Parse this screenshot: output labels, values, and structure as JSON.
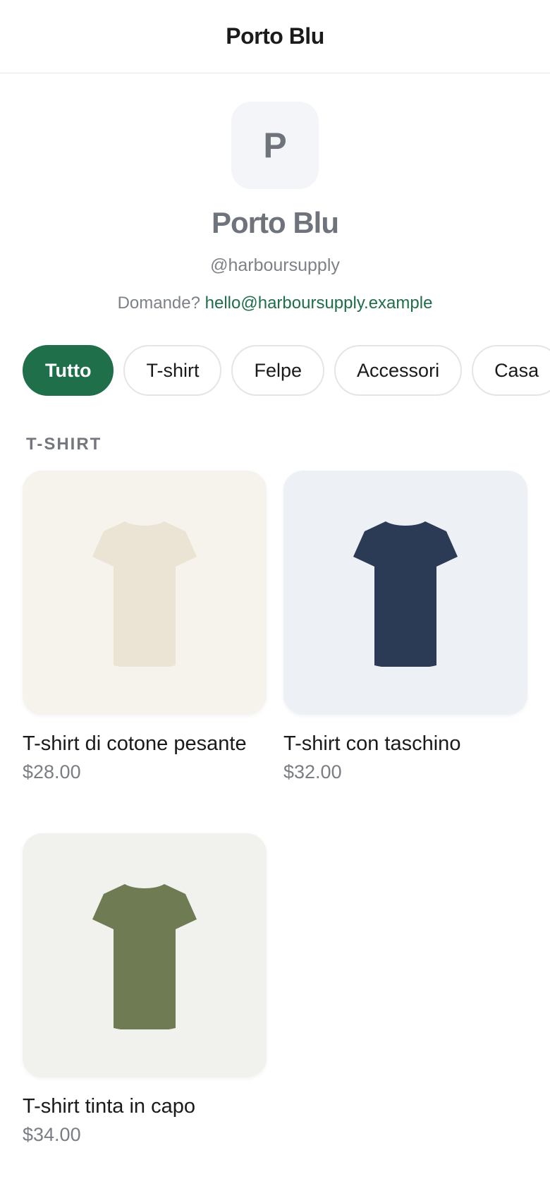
{
  "header": {
    "title": "Porto Blu"
  },
  "profile": {
    "avatar_letter": "P",
    "name": "Porto Blu",
    "handle": "@harboursupply",
    "contact_prefix": "Domande?",
    "contact_email": "hello@harboursupply.example"
  },
  "categories": [
    {
      "label": "Tutto",
      "active": true
    },
    {
      "label": "T-shirt",
      "active": false
    },
    {
      "label": "Felpe",
      "active": false
    },
    {
      "label": "Accessori",
      "active": false
    },
    {
      "label": "Casa",
      "active": false
    }
  ],
  "section": {
    "label": "T-SHIRT"
  },
  "products": [
    {
      "title": "T-shirt di cotone pesante",
      "price": "$28.00",
      "bg_color": "#f6f2ec",
      "shirt_color": "#ebe3d3",
      "icon": "tshirt-icon"
    },
    {
      "title": "T-shirt con taschino",
      "price": "$32.00",
      "bg_color": "#edf0f5",
      "shirt_color": "#2b3a55",
      "icon": "tshirt-icon"
    },
    {
      "title": "T-shirt tinta in capo",
      "price": "$34.00",
      "bg_color": "#f1f2ed",
      "shirt_color": "#6f7b52",
      "icon": "tshirt-icon"
    }
  ],
  "colors": {
    "accent": "#1f6f4b",
    "muted_text": "#7d8188"
  }
}
